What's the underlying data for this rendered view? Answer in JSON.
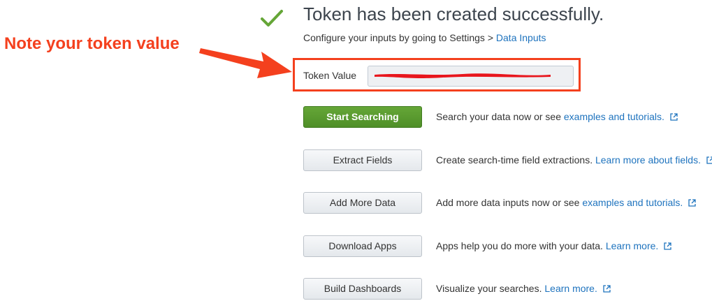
{
  "header": {
    "title": "Token has been created successfully.",
    "subtitle_prefix": "Configure your inputs by going to Settings > ",
    "subtitle_link": "Data Inputs",
    "success_color": "#65a637"
  },
  "annotation": {
    "text": "Note your token value",
    "color": "#f4401e"
  },
  "token": {
    "label": "Token Value",
    "value": "",
    "redacted": true
  },
  "actions": [
    {
      "button_label": "Start Searching",
      "style": "primary",
      "description": "Search your data now or see ",
      "link_text": "examples and tutorials.",
      "external_icon": "external-link-icon"
    },
    {
      "button_label": "Extract Fields",
      "style": "default",
      "description": "Create search-time field extractions. ",
      "link_text": "Learn more about fields.",
      "external_icon": "external-link-icon"
    },
    {
      "button_label": "Add More Data",
      "style": "default",
      "description": "Add more data inputs now or see ",
      "link_text": "examples and tutorials.",
      "external_icon": "external-link-icon"
    },
    {
      "button_label": "Download Apps",
      "style": "default",
      "description": "Apps help you do more with your data. ",
      "link_text": "Learn more.",
      "external_icon": "external-link-icon"
    },
    {
      "button_label": "Build Dashboards",
      "style": "default",
      "description": "Visualize your searches. ",
      "link_text": "Learn more.",
      "external_icon": "external-link-icon"
    }
  ],
  "colors": {
    "link": "#1e73be",
    "primary_button": "#5c9e33",
    "redaction": "#e8161d"
  }
}
